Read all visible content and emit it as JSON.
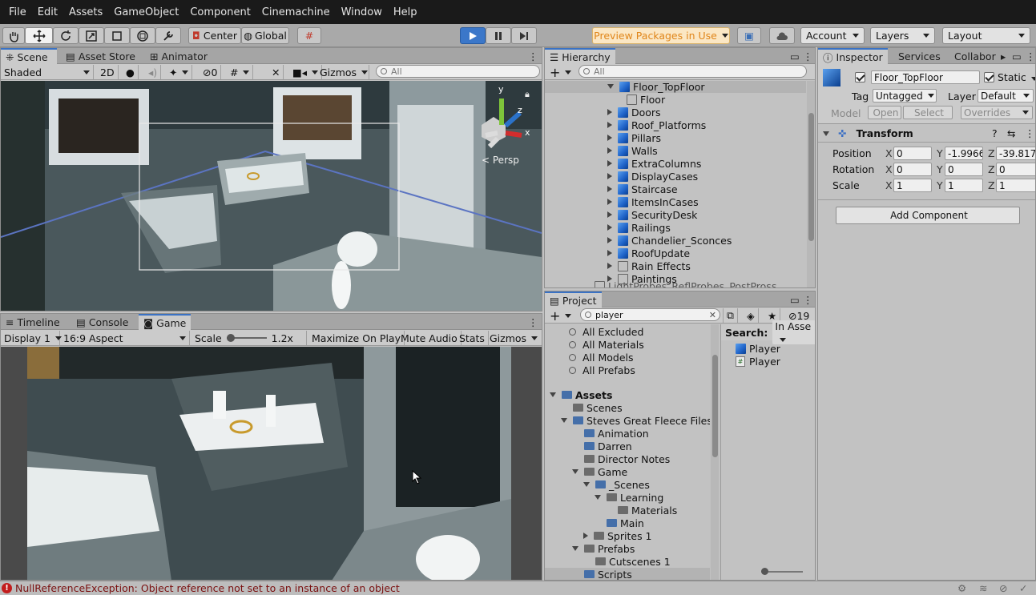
{
  "menu": [
    "File",
    "Edit",
    "Assets",
    "GameObject",
    "Component",
    "Cinemachine",
    "Window",
    "Help"
  ],
  "toolbar": {
    "pivot": "Center",
    "space": "Global",
    "preview_packages": "Preview Packages in Use",
    "account": "Account",
    "layers": "Layers",
    "layout": "Layout",
    "preview_color": "#f3a23c"
  },
  "scene": {
    "tabs": [
      "Scene",
      "Asset Store",
      "Animator"
    ],
    "shading": "Shaded",
    "mode_2d": "2D",
    "hidden_count": "0",
    "gizmos": "Gizmos",
    "search_placeholder": "All",
    "persp": "Persp",
    "gizmo_y": "y",
    "gizmo_z": "z",
    "gizmo_x": "x"
  },
  "game": {
    "tabs": [
      "Timeline",
      "Console",
      "Game"
    ],
    "display": "Display 1",
    "aspect": "16:9 Aspect",
    "scale_label": "Scale",
    "scale_value": "1.2x",
    "maximize": "Maximize On Play",
    "mute": "Mute Audio",
    "stats": "Stats",
    "gizmos": "Gizmos"
  },
  "hierarchy": {
    "title": "Hierarchy",
    "search_placeholder": "All",
    "items": [
      {
        "label": "Floor_TopFloor",
        "expanded": true,
        "icon": "cube",
        "level": 0
      },
      {
        "label": "Floor",
        "icon": "empty",
        "level": 1
      },
      {
        "label": "Doors",
        "icon": "cube",
        "level": 0
      },
      {
        "label": "Roof_Platforms",
        "icon": "cube",
        "level": 0
      },
      {
        "label": "Pillars",
        "icon": "cube",
        "level": 0
      },
      {
        "label": "Walls",
        "icon": "cube",
        "level": 0
      },
      {
        "label": "ExtraColumns",
        "icon": "cube",
        "level": 0
      },
      {
        "label": "DisplayCases",
        "icon": "cube",
        "level": 0
      },
      {
        "label": "Staircase",
        "icon": "cube",
        "level": 0
      },
      {
        "label": "ItemsInCases",
        "icon": "cube",
        "level": 0
      },
      {
        "label": "SecurityDesk",
        "icon": "cube",
        "level": 0
      },
      {
        "label": "Railings",
        "icon": "cube",
        "level": 0
      },
      {
        "label": "Chandelier_Sconces",
        "icon": "cube",
        "level": 0
      },
      {
        "label": "RoofUpdate",
        "icon": "cube",
        "level": 0
      },
      {
        "label": "Rain Effects",
        "icon": "empty",
        "level": 0
      },
      {
        "label": "Paintings",
        "icon": "empty",
        "level": 0
      }
    ],
    "cut_item": "LightProbes_ReflProbes_PostPross"
  },
  "project": {
    "title": "Project",
    "search_value": "player",
    "hidden_count": "19",
    "search_label": "Search:",
    "search_scope": "In Asse",
    "favorites": [
      "All Excluded",
      "All Materials",
      "All Models",
      "All Prefabs"
    ],
    "tree": [
      {
        "label": "Assets",
        "level": 0,
        "arrow": "down",
        "bold": true
      },
      {
        "label": "Scenes",
        "level": 1,
        "arrow": "none"
      },
      {
        "label": "Steves Great Fleece Files",
        "level": 1,
        "arrow": "down"
      },
      {
        "label": "Animation",
        "level": 2,
        "arrow": "none"
      },
      {
        "label": "Darren",
        "level": 2,
        "arrow": "none"
      },
      {
        "label": "Director Notes",
        "level": 2,
        "arrow": "none"
      },
      {
        "label": "Game",
        "level": 2,
        "arrow": "down"
      },
      {
        "label": "_Scenes",
        "level": 3,
        "arrow": "down"
      },
      {
        "label": "Learning",
        "level": 4,
        "arrow": "down"
      },
      {
        "label": "Materials",
        "level": 5,
        "arrow": "none"
      },
      {
        "label": "Main",
        "level": 4,
        "arrow": "none"
      },
      {
        "label": "Sprites 1",
        "level": 3,
        "arrow": "right"
      },
      {
        "label": "Prefabs",
        "level": 2,
        "arrow": "down"
      },
      {
        "label": "Cutscenes 1",
        "level": 3,
        "arrow": "none"
      },
      {
        "label": "Scripts",
        "level": 2,
        "arrow": "none"
      }
    ],
    "results": [
      "Player",
      "Player"
    ]
  },
  "inspector": {
    "tabs": [
      "Inspector",
      "Services",
      "Collabor"
    ],
    "object_name": "Floor_TopFloor",
    "static_label": "Static",
    "tag_label": "Tag",
    "tag_value": "Untagged",
    "layer_label": "Layer",
    "layer_value": "Default",
    "model_label": "Model",
    "open": "Open",
    "select": "Select",
    "overrides": "Overrides",
    "transform_title": "Transform",
    "rows": [
      {
        "label": "Position",
        "x": "0",
        "y": "-1.9966",
        "z": "-39.817"
      },
      {
        "label": "Rotation",
        "x": "0",
        "y": "0",
        "z": "0"
      },
      {
        "label": "Scale",
        "x": "1",
        "y": "1",
        "z": "1"
      }
    ],
    "add_component": "Add Component"
  },
  "status": {
    "error": "NullReferenceException: Object reference not set to an instance of an object"
  }
}
